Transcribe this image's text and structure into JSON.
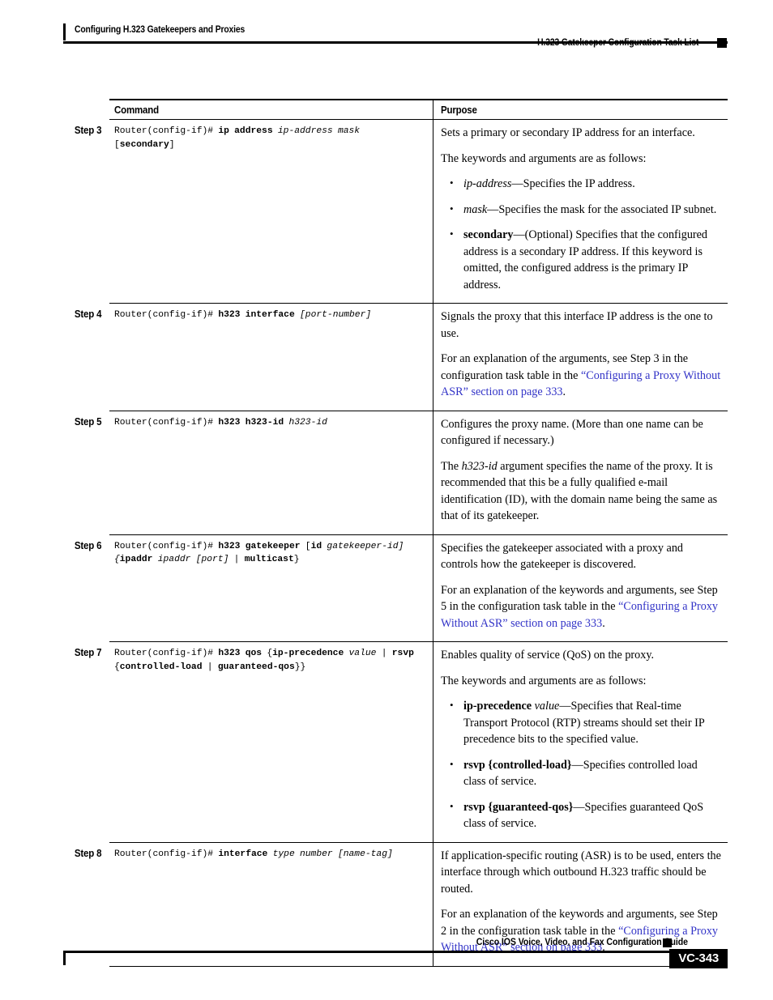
{
  "header": {
    "left_title": "Configuring H.323 Gatekeepers and Proxies",
    "right_title": "H.323 Gatekeeper Configuration Task List"
  },
  "table": {
    "columns": {
      "command": "Command",
      "purpose": "Purpose"
    },
    "rows": [
      {
        "step_label": "Step 3",
        "command": {
          "prompt": "Router(config-if)# ",
          "keyword": "ip address",
          "args": " ip-address mask",
          "line2_open": "[",
          "line2_keyword": "secondary",
          "line2_close": "]"
        },
        "purpose": {
          "para1": "Sets a primary or secondary IP address for an interface.",
          "para2": "The keywords and arguments are as follows:",
          "bullets": [
            {
              "term": "ip-address",
              "term_style": "italic",
              "rest": "—Specifies the IP address."
            },
            {
              "term": "mask",
              "term_style": "italic",
              "rest": "—Specifies the mask for the associated IP subnet."
            },
            {
              "term": "secondary",
              "term_style": "bold",
              "rest": "—(Optional) Specifies that the configured address is a secondary IP address. If this keyword is omitted, the configured address is the primary IP address."
            }
          ]
        }
      },
      {
        "step_label": "Step 4",
        "command": {
          "prompt": "Router(config-if)# ",
          "keyword": "h323 interface",
          "args": " [port-number]"
        },
        "purpose": {
          "para1": "Signals the proxy that this interface IP address is the one to use.",
          "para2_pre": "For an explanation of the arguments, see Step 3 in the configuration task table in the ",
          "para2_link": "“Configuring a Proxy Without ASR” section on page 333",
          "para2_post": "."
        }
      },
      {
        "step_label": "Step 5",
        "command": {
          "prompt": "Router(config-if)# ",
          "keyword": "h323 h323-id",
          "args": " h323-id"
        },
        "purpose": {
          "para1": "Configures the proxy name. (More than one name can be configured if necessary.)",
          "para2_pre": "The ",
          "para2_italic": "h323-id",
          "para2_post": " argument specifies the name of the proxy. It is recommended that this be a fully qualified e-mail identification (ID), with the domain name being the same as that of its gatekeeper."
        }
      },
      {
        "step_label": "Step 6",
        "command": {
          "prompt": "Router(config-if)# ",
          "keyword": "h323 gatekeeper",
          "args": " [",
          "kw2": "id",
          "args2": " gatekeeper-id] {",
          "kw3": "ipaddr",
          "args3": " ipaddr [port] | ",
          "kw4": "multicast",
          "args4": "}"
        },
        "purpose": {
          "para1": "Specifies the gatekeeper associated with a proxy and controls how the gatekeeper is discovered.",
          "para2_pre": "For an explanation of the keywords and arguments, see Step 5 in the configuration task table in the ",
          "para2_link": "“Configuring a Proxy Without ASR” section on page 333",
          "para2_post": "."
        }
      },
      {
        "step_label": "Step 7",
        "command": {
          "prompt": "Router(config-if)# ",
          "keyword": "h323 qos",
          "args": " {",
          "kw2": "ip-precedence",
          "args2": " value | ",
          "kw3": "rsvp",
          "args3": " {",
          "kw4": "controlled-load",
          "args4": " | ",
          "kw5": "guaranteed-qos",
          "args5": "}}"
        },
        "purpose": {
          "para1": "Enables quality of service (QoS) on the proxy.",
          "para2": "The keywords and arguments are as follows:",
          "bullets": [
            {
              "term": "ip-precedence",
              "term_style": "bold",
              "term2": "value",
              "term2_style": "italic",
              "rest": "—Specifies that Real-time Transport Protocol (RTP) streams should set their IP precedence bits to the specified value."
            },
            {
              "term": "rsvp {controlled-load}",
              "term_style": "bold",
              "rest": "—Specifies controlled load class of service."
            },
            {
              "term": "rsvp {guaranteed-qos}",
              "term_style": "bold",
              "rest": "—Specifies guaranteed QoS class of service."
            }
          ]
        }
      },
      {
        "step_label": "Step 8",
        "command": {
          "prompt": "Router(config-if)# ",
          "keyword": "interface",
          "args": " type number [name-tag]"
        },
        "purpose": {
          "para1": "If application-specific routing (ASR) is to be used, enters the interface through which outbound H.323 traffic should be routed.",
          "para2_pre": "For an explanation of the keywords and arguments, see Step 2 in the configuration task table in the ",
          "para2_link": "“Configuring a Proxy Without ASR” section on page 333",
          "para2_post": "."
        }
      }
    ]
  },
  "footer": {
    "guide_title": "Cisco IOS Voice, Video, and Fax Configuration Guide",
    "page_number": "VC-343"
  },
  "colors": {
    "link": "#3233c7",
    "rule": "#000000"
  }
}
